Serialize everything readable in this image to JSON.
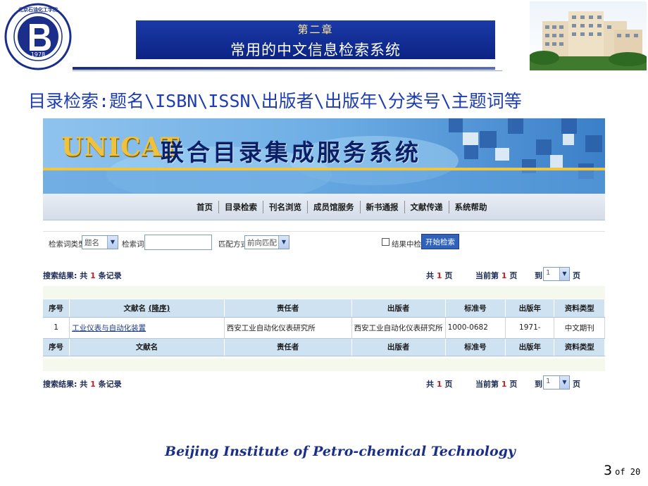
{
  "slide": {
    "logo_text": "北京石油化工学院",
    "logo_year": "1978",
    "logo_en": "BEIJING INSTITUTE OF PETROCHEMICAL TECHNOLOGY",
    "chapter": "第二章",
    "title": "常用的中文信息检索系统",
    "heading": "目录检索:题名\\ISBN\\ISSN\\出版者\\出版年\\分类号\\主题词等",
    "footer": "Beijing  Institute  of Petro-chemical Technology",
    "page_current": "3",
    "page_of": "of 20"
  },
  "unicat": {
    "brand": "UNICAT",
    "system_name": "联合目录集成服务系统",
    "nav": [
      "首页",
      "目录检索",
      "刊名浏览",
      "成员馆服务",
      "新书通报",
      "文献传递",
      "系统帮助"
    ],
    "search": {
      "type_label": "检索词类型:",
      "type_value": "题名",
      "keyword_label": "检索词:",
      "keyword_value": "",
      "match_label": "匹配方式:",
      "match_value": "前向匹配",
      "within_label": "结果中检索",
      "submit_label": "开始检索"
    },
    "results": {
      "prefix": "搜索结果: 共",
      "count": "1",
      "suffix": "条记录",
      "pages_prefix": "共",
      "pages": "1",
      "pages_suffix": "页",
      "current_prefix": "当前第",
      "current": "1",
      "current_suffix": "页",
      "goto_label": "到",
      "goto_value": "1",
      "goto_suffix": "页"
    },
    "table": {
      "headers": [
        "序号",
        "文献名",
        "(降序)",
        "责任者",
        "出版者",
        "标准号",
        "出版年",
        "资料类型"
      ],
      "footer_headers": [
        "序号",
        "文献名",
        "责任者",
        "出版者",
        "标准号",
        "出版年",
        "资料类型"
      ],
      "rows": [
        {
          "no": "1",
          "title": "工业仪表与自动化装置",
          "author": "西安工业自动化仪表研究所",
          "publisher": "西安工业自动化仪表研究所",
          "issn": "1000-0682",
          "year": "1971-",
          "type": "中文期刊"
        }
      ]
    }
  }
}
